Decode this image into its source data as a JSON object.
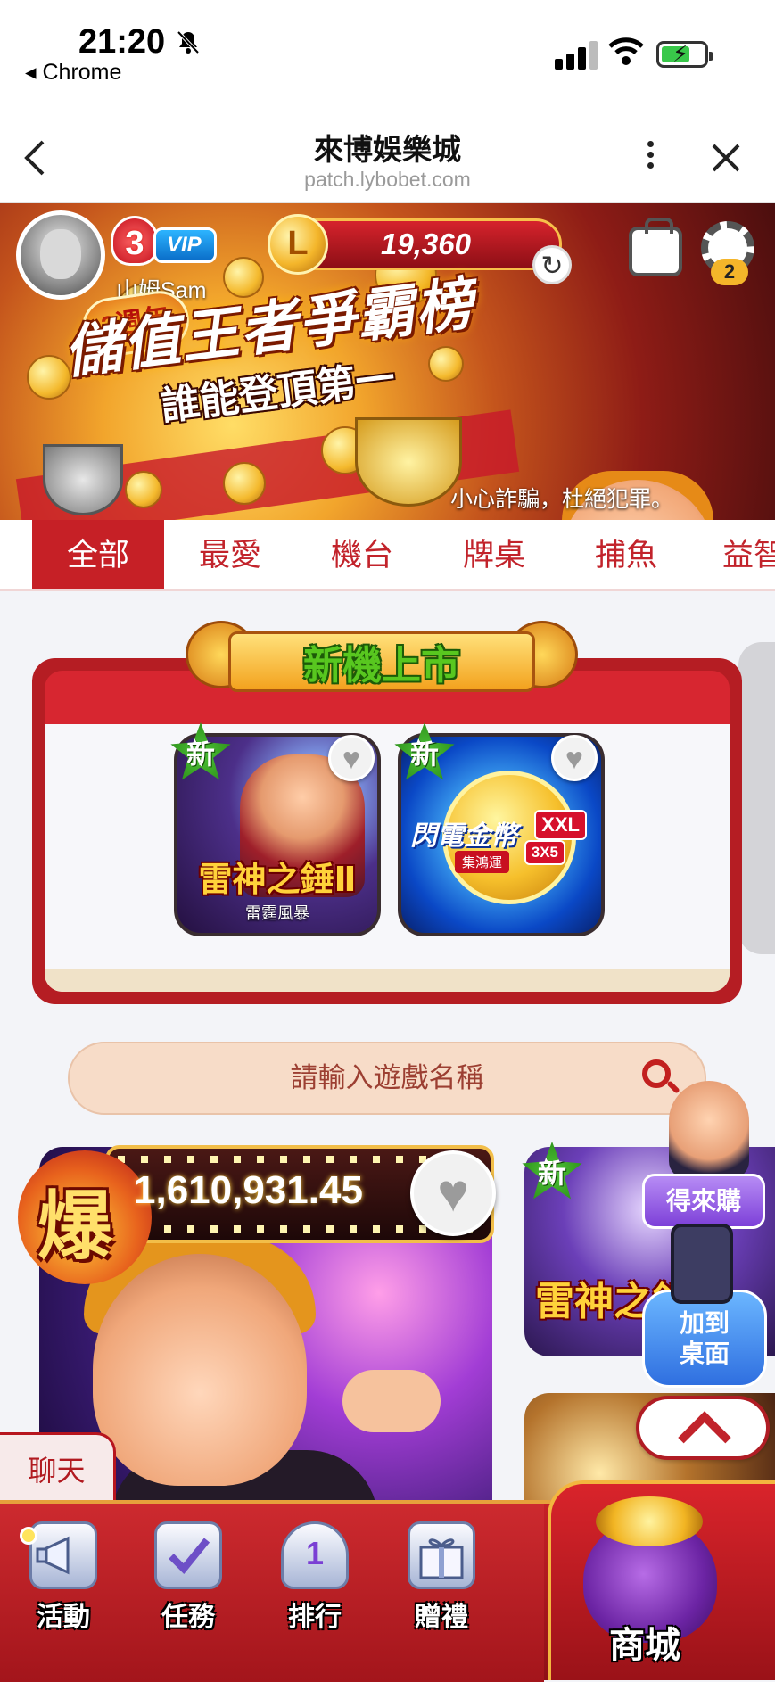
{
  "status_bar": {
    "time": "21:20",
    "back_app": "◂ Chrome",
    "icons": [
      "bell-mute-icon",
      "signal-icon",
      "wifi-icon",
      "battery-charging-icon"
    ]
  },
  "browser_nav": {
    "title": "來博娛樂城",
    "url": "patch.lybobet.com",
    "icons": [
      "back-icon",
      "more-vertical-icon",
      "close-icon"
    ]
  },
  "banner": {
    "vip_level": "3",
    "vip_label": "VIP",
    "username": "山姆Sam",
    "coin_symbol": "L",
    "balance": "19,360",
    "settings_badge": "2",
    "anniversary": "3週年",
    "promo_title": "儲值王者爭霸榜",
    "promo_subtitle": "誰能登頂第一",
    "notice": "小心詐騙，杜絕犯罪。"
  },
  "tabs": [
    {
      "label": "全部",
      "active": true
    },
    {
      "label": "最愛",
      "active": false
    },
    {
      "label": "機台",
      "active": false
    },
    {
      "label": "牌桌",
      "active": false
    },
    {
      "label": "捕魚",
      "active": false
    },
    {
      "label": "益智",
      "active": false
    }
  ],
  "featured": {
    "title": "新機上市",
    "games": [
      {
        "badge": "新",
        "title": "雷神之錘Ⅱ",
        "subtitle": "雷霆風暴"
      },
      {
        "badge": "新",
        "title": "閃電金幣",
        "tag": "XXL",
        "tag2": "3X5",
        "subtitle": "集鴻運"
      }
    ]
  },
  "search": {
    "placeholder": "請輸入遊戲名稱"
  },
  "jackpot": {
    "label": "爆",
    "value": "1,610,931.45"
  },
  "side_game": {
    "badge": "新",
    "title": "雷神之錘"
  },
  "floating": {
    "buy_label": "得來購",
    "add_line1": "加到",
    "add_line2": "桌面"
  },
  "chat_label": "聊天",
  "bottom_nav": [
    {
      "label": "活動",
      "icon": "megaphone-icon"
    },
    {
      "label": "任務",
      "icon": "task-check-icon"
    },
    {
      "label": "排行",
      "icon": "trophy-icon",
      "icon_text": "1"
    },
    {
      "label": "贈禮",
      "icon": "gift-icon"
    }
  ],
  "shop_label": "商城",
  "colors": {
    "brand_red": "#c62026",
    "gold": "#f2be49",
    "new_green": "#3aa61f"
  }
}
